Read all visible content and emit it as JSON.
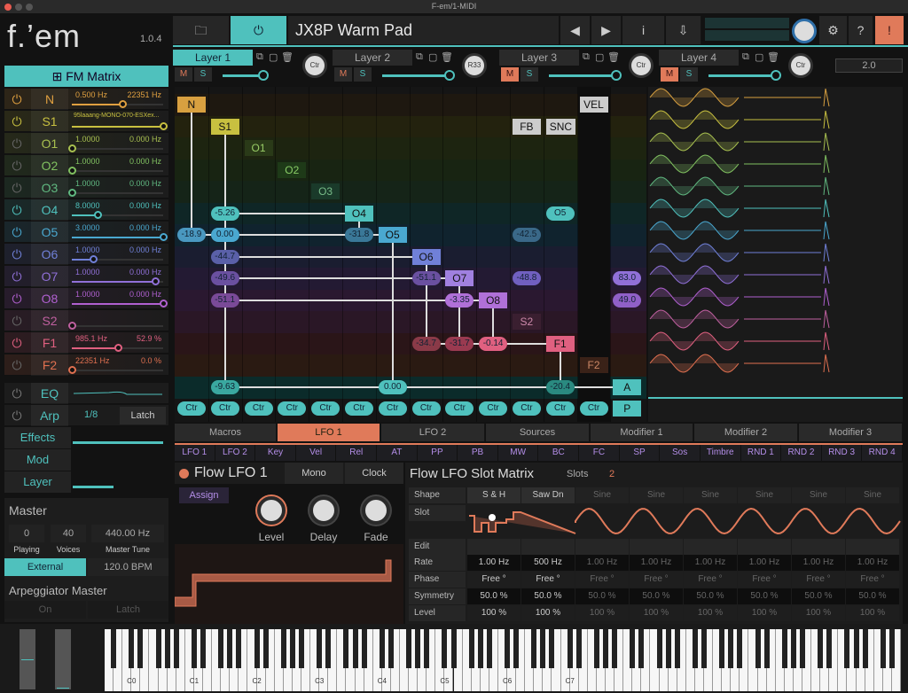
{
  "window": {
    "title": "F-em/1-MIDI"
  },
  "app": {
    "logo": "f.’em",
    "version": "1.0.4"
  },
  "toolbar": {
    "folder_icon": "folder-icon",
    "power_icon": "power-icon",
    "preset_name": "JX8P Warm Pad",
    "prev": "◀",
    "next": "▶",
    "info": "i",
    "save_icon": "export-icon",
    "settings": "⚙",
    "help": "?",
    "alert": "!"
  },
  "layers": [
    {
      "label": "Layer 1",
      "dial": "Ctr",
      "mute": "M",
      "solo": "S",
      "level": 0.55,
      "active": true,
      "muted": false
    },
    {
      "label": "Layer 2",
      "dial": "R33",
      "mute": "M",
      "solo": "S",
      "level": 0.9,
      "active": false,
      "muted": false
    },
    {
      "label": "Layer 3",
      "dial": "Ctr",
      "mute": "M",
      "solo": "S",
      "level": 0.9,
      "active": false,
      "muted": true
    },
    {
      "label": "Layer 4",
      "dial": "Ctr",
      "mute": "M",
      "solo": "S",
      "level": 0.9,
      "active": false,
      "muted": true
    }
  ],
  "layer_value": "2.0",
  "left": {
    "fm_matrix": "FM Matrix",
    "rows": [
      {
        "label": "N",
        "v1": "0.500 Hz",
        "v2": "22351 Hz",
        "pos": 0.55,
        "color": "#e0a040",
        "on": true
      },
      {
        "label": "S1",
        "v1": "95laaang-MONO-070-ESXex...",
        "v2": "",
        "pos": 1.0,
        "color": "#c8c040",
        "on": true
      },
      {
        "label": "O1",
        "v1": "1.0000",
        "v2": "0.000 Hz",
        "pos": 0.0,
        "color": "#a8c050",
        "on": false
      },
      {
        "label": "O2",
        "v1": "1.0000",
        "v2": "0.000 Hz",
        "pos": 0.0,
        "color": "#80c060",
        "on": false
      },
      {
        "label": "O3",
        "v1": "1.0000",
        "v2": "0.000 Hz",
        "pos": 0.0,
        "color": "#60b880",
        "on": false
      },
      {
        "label": "O4",
        "v1": "8.0000",
        "v2": "0.000 Hz",
        "pos": 0.28,
        "color": "#4fc1bd",
        "on": true
      },
      {
        "label": "O5",
        "v1": "3.0000",
        "v2": "0.000 Hz",
        "pos": 1.0,
        "color": "#4aa8d0",
        "on": true
      },
      {
        "label": "O6",
        "v1": "1.0000",
        "v2": "0.000 Hz",
        "pos": 0.23,
        "color": "#7080d8",
        "on": true
      },
      {
        "label": "O7",
        "v1": "1.0000",
        "v2": "0.000 Hz",
        "pos": 0.91,
        "color": "#9070d8",
        "on": true
      },
      {
        "label": "O8",
        "v1": "1.0000",
        "v2": "0.000 Hz",
        "pos": 1.0,
        "color": "#b060d0",
        "on": true
      },
      {
        "label": "S2",
        "v1": "",
        "v2": "",
        "pos": 0.0,
        "color": "#c060a0",
        "on": false
      },
      {
        "label": "F1",
        "v1": "985.1 Hz",
        "v2": "52.9 %",
        "pos": 0.5,
        "color": "#e06080",
        "on": true
      },
      {
        "label": "F2",
        "v1": "22351 Hz",
        "v2": "0.0 %",
        "pos": 0.0,
        "color": "#e07050",
        "on": false
      }
    ],
    "eq": "EQ",
    "arp": "Arp",
    "arp_rate": "1/8",
    "arp_latch": "Latch",
    "effects": "Effects",
    "effects_level": 1.0,
    "mod": "Mod",
    "layer": "Layer",
    "layer_level": 0.45
  },
  "master": {
    "title": "Master",
    "playing": "0",
    "voices": "40",
    "tune": "440.00 Hz",
    "playing_label": "Playing",
    "voices_label": "Voices",
    "tune_label": "Master Tune",
    "sync": "External",
    "bpm": "120.0 BPM",
    "arp_title": "Arpeggiator Master",
    "arp_on": "On",
    "arp_latch": "Latch"
  },
  "matrix": {
    "nodes": [
      "N",
      "S1",
      "O1",
      "O2",
      "O3",
      "O4",
      "O5",
      "O6",
      "O7",
      "O8",
      "S2",
      "F1",
      "F2",
      "FB",
      "SNC",
      "VEL",
      "A",
      "P"
    ],
    "values": {
      "s1_o4": "-5.26",
      "n_o5": "-18.9",
      "s1_o5": "0.00",
      "o4_o5": "-31.8",
      "fb_o5": "-42.5",
      "snc_o4": "O5",
      "s1_o6": "-44.7",
      "s1_o7": "-49.6",
      "o6_o7": "-51.1",
      "fb_o7": "-48.8",
      "vel_o7": "83.0",
      "s1_o8": "-51.1",
      "o7_o8": "-3.35",
      "vel_o8": "49.0",
      "o6_f1": "-34.7",
      "o7_f1": "-31.7",
      "o8_f1": "-0.14",
      "s1_a": "-9.63",
      "o5_a": "0.00",
      "f1_a": "-20.4"
    },
    "ctr": "Ctr"
  },
  "modtabs": [
    "Macros",
    "LFO 1",
    "LFO 2",
    "Sources",
    "Modifier 1",
    "Modifier 2",
    "Modifier 3"
  ],
  "sources": [
    "LFO 1",
    "LFO 2",
    "Key",
    "Vel",
    "Rel",
    "AT",
    "PP",
    "PB",
    "MW",
    "BC",
    "FC",
    "SP",
    "Sos",
    "Timbre",
    "RND 1",
    "RND 2",
    "RND 3",
    "RND 4"
  ],
  "lfo": {
    "title": "Flow LFO 1",
    "mono": "Mono",
    "clock": "Clock",
    "assign": "Assign",
    "knobs": [
      {
        "label": "Level",
        "value": 0.8
      },
      {
        "label": "Delay",
        "value": 0.0
      },
      {
        "label": "Fade",
        "value": 0.5
      }
    ]
  },
  "slotmatrix": {
    "title": "Flow LFO Slot Matrix",
    "slots_label": "Slots",
    "slots": "2",
    "row_labels": [
      "Shape",
      "Slot",
      "Edit",
      "Rate",
      "Phase",
      "Symmetry",
      "Level"
    ],
    "shapes": [
      "S & H",
      "Saw Dn",
      "Sine",
      "Sine",
      "Sine",
      "Sine",
      "Sine",
      "Sine"
    ],
    "rates": [
      "1.00 Hz",
      "500 Hz",
      "1.00 Hz",
      "1.00 Hz",
      "1.00 Hz",
      "1.00 Hz",
      "1.00 Hz",
      "1.00 Hz"
    ],
    "phase": [
      "Free °",
      "Free °",
      "Free °",
      "Free °",
      "Free °",
      "Free °",
      "Free °",
      "Free °"
    ],
    "symmetry": [
      "50.0 %",
      "50.0 %",
      "50.0 %",
      "50.0 %",
      "50.0 %",
      "50.0 %",
      "50.0 %",
      "50.0 %"
    ],
    "level": [
      "100 %",
      "100 %",
      "100 %",
      "100 %",
      "100 %",
      "100 %",
      "100 %",
      "100 %"
    ]
  },
  "keyboard": {
    "labels": [
      "C0",
      "C1",
      "C2",
      "C3",
      "C4",
      "C5",
      "C6",
      "C7"
    ],
    "pitch": 0.5,
    "mod": 0.0
  }
}
